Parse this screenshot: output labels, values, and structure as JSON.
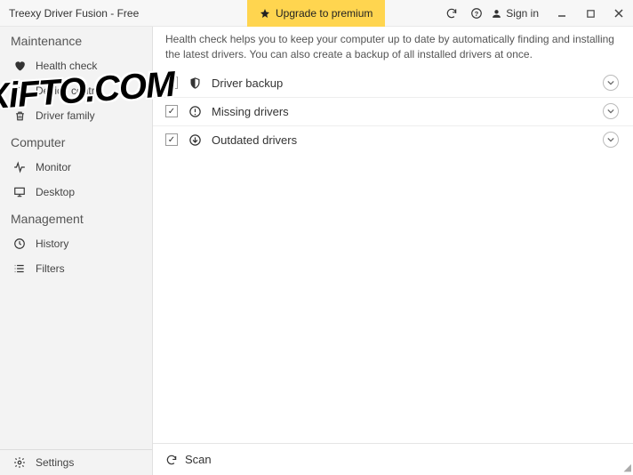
{
  "titlebar": {
    "title": "Treexy Driver Fusion - Free",
    "upgrade": "Upgrade to premium",
    "signin": "Sign in"
  },
  "sidebar": {
    "sections": {
      "maintenance": "Maintenance",
      "computer": "Computer",
      "management": "Management"
    },
    "items": {
      "health_check": "Health check",
      "device_control": "Device control",
      "driver_family": "Driver family",
      "monitor": "Monitor",
      "desktop": "Desktop",
      "history": "History",
      "filters": "Filters",
      "settings": "Settings"
    }
  },
  "main": {
    "info": "Health check helps you to keep your computer up to date by automatically finding and installing the latest drivers. You can also create a backup of all installed drivers at once.",
    "rows": {
      "driver_backup": "Driver backup",
      "missing_drivers": "Missing drivers",
      "outdated_drivers": "Outdated drivers"
    },
    "scan": "Scan"
  },
  "watermark": "XiFTO.COM"
}
